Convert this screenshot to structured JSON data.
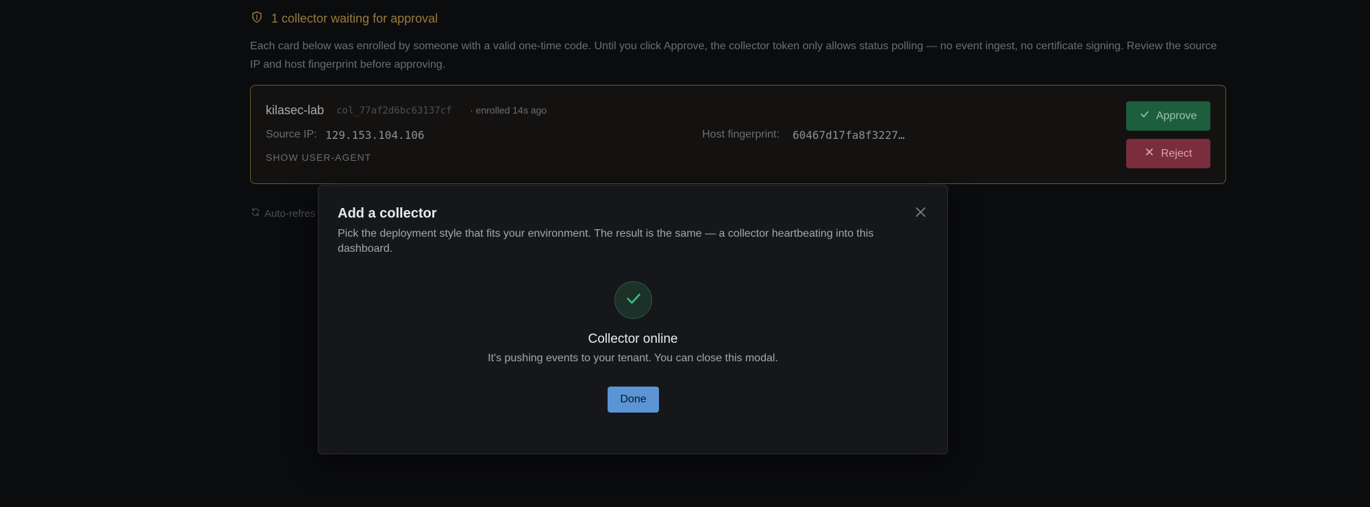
{
  "approval": {
    "header": "1 collector waiting for approval",
    "description": "Each card below was enrolled by someone with a valid one-time code. Until you click Approve, the collector token only allows status polling — no event ingest, no certificate signing. Review the source IP and host fingerprint before approving."
  },
  "pending_card": {
    "name": "kilasec-lab",
    "id": "col_77af2d6bc63137cf",
    "enrolled": "· enrolled 14s ago",
    "source_ip_label": "Source IP:",
    "source_ip": "129.153.104.106",
    "fingerprint_label": "Host fingerprint:",
    "fingerprint": "60467d17fa8f3227…",
    "show_user_agent": "SHOW USER-AGENT",
    "approve_label": "Approve",
    "reject_label": "Reject"
  },
  "auto_refresh": "Auto-refres",
  "modal": {
    "title": "Add a collector",
    "subtitle": "Pick the deployment style that fits your environment. The result is the same — a collector heartbeating into this dashboard.",
    "status_title": "Collector online",
    "status_desc": "It's pushing events to your tenant. You can close this modal.",
    "done_label": "Done"
  },
  "colors": {
    "accent_warning": "#9a7a3c",
    "approve": "#1d5e3e",
    "reject": "#7a2d3c",
    "success": "#3fbf86",
    "primary": "#5b95d6"
  }
}
